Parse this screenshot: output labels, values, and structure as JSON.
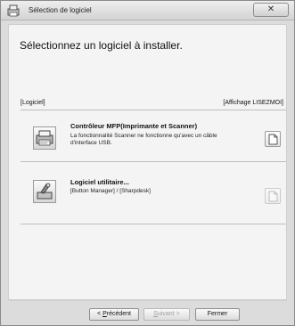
{
  "window": {
    "title": "Sélection de logiciel",
    "close_label": "✕"
  },
  "main": {
    "heading": "Sélectionnez un logiciel à installer.",
    "list_header_left": "[Logiciel]",
    "list_header_right": "[Affichage LISEZMOI]",
    "items": [
      {
        "title": "Contrôleur MFP(Imprimante et Scanner)",
        "description_line1": "La fonctionnalité Scanner ne fonctionne qu'avec un câble",
        "description_line2": "d'interface USB.",
        "icon": "printer-scanner-icon",
        "readme_enabled": true
      },
      {
        "title": "Logiciel utilitaire...",
        "description_line1": "[Button Manager] / [Sharpdesk]",
        "icon": "tools-icon",
        "readme_enabled": false
      }
    ]
  },
  "footer": {
    "back_prefix": "< ",
    "back_mnemonic": "P",
    "back_rest": "récédent",
    "next_mnemonic": "S",
    "next_rest": "uivant >",
    "close_label": "Fermer"
  }
}
